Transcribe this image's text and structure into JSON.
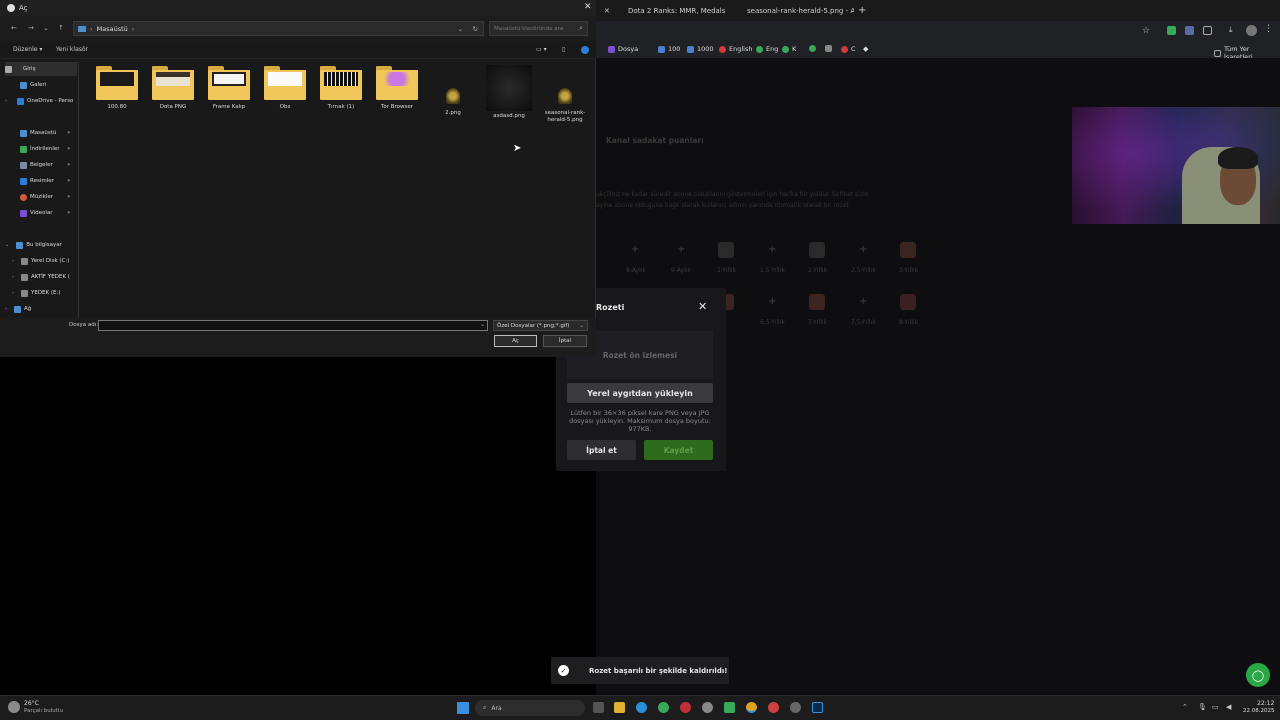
{
  "browser": {
    "tabs": [
      {
        "label": "Dota 2 Ranks: MMR, Medals an"
      },
      {
        "label": "seasonal-rank-herald-5.png - A"
      }
    ],
    "new_tab_icon": "plus-icon",
    "bookmarks": [
      {
        "label": "Dosya",
        "color": "#7a4fd1"
      },
      {
        "label": "100",
        "color": "#4a7fd1"
      },
      {
        "label": "1000",
        "color": "#4a7fd1"
      },
      {
        "label": "English",
        "color": "#d13a3a"
      },
      {
        "label": "Eng",
        "color": "#3aa85a"
      },
      {
        "label": "K",
        "color": "#3aa85a"
      },
      {
        "label": "C",
        "color": "#d13a3a"
      }
    ],
    "all_bookmarks": "Tüm Yer İşaretleri"
  },
  "page": {
    "section_title": "Kanal sadakat puanları",
    "desc_line1": "ukçiliniz ne kadar süredir abone olduklarını göstermeleri için harika bir yoldur. Sohbet sizin",
    "desc_line2": "ayine abone olduğuna bağlı olarak kullanıcı adının yanında otomatik olarak bir rozet",
    "row1_labels": [
      "8-Aylık",
      "9-Aylık",
      "1-Yıllık",
      "1,5-Yıllık",
      "2-Yıllık",
      "2,5-Yıllık",
      "3-Yıllık"
    ],
    "row2_labels": [
      "6,5-Yıllık",
      "7-Yıllık",
      "7,5-Yıllık",
      "8-Yıllık"
    ]
  },
  "badge_modal": {
    "title": "Rozeti",
    "preview_label": "Rozet ön izlemesi",
    "upload_label": "Yerel aygıtdan yükleyin",
    "hint": "Lütfen bir 36×36 piksel kare PNG veya JPG dosyası yükleyin. Maksimum dosya boyutu: 977KB.",
    "cancel_label": "İptal et",
    "save_label": "Kaydet",
    "save_color": "#2f6b1e"
  },
  "toast": {
    "message": "Rozet başarılı bir şekilde kaldırıldı!"
  },
  "file_dialog": {
    "title": "Aç",
    "path_root": "Masaüstü",
    "search_placeholder": "Masaüstü klasöründe ara",
    "toolbar": {
      "organize": "Düzenle",
      "new_folder": "Yeni klasör"
    },
    "sidebar": [
      {
        "label": "Giriş",
        "icon": "home-icon",
        "color": "#aaaaaa",
        "pinned": false
      },
      {
        "label": "Galeri",
        "icon": "gallery-icon",
        "color": "#4a8fd1",
        "pinned": false
      },
      {
        "label": "OneDrive - Perso",
        "icon": "cloud-icon",
        "color": "#2b7fd6",
        "pinned": false
      },
      {
        "label": "Masaüstü",
        "icon": "desktop-icon",
        "color": "#4a8fd1",
        "pinned": true
      },
      {
        "label": "İndirilenler",
        "icon": "download-icon",
        "color": "#3aa85a",
        "pinned": true
      },
      {
        "label": "Belgeler",
        "icon": "document-icon",
        "color": "#7a8aa0",
        "pinned": true
      },
      {
        "label": "Resimler",
        "icon": "picture-icon",
        "color": "#2b7fd6",
        "pinned": true
      },
      {
        "label": "Müzikler",
        "icon": "music-icon",
        "color": "#d15a3a",
        "pinned": true
      },
      {
        "label": "Videolar",
        "icon": "video-icon",
        "color": "#7a4fd1",
        "pinned": true
      },
      {
        "label": "Bu bilgisayar",
        "icon": "computer-icon",
        "color": "#4a8fd1",
        "pinned": false
      },
      {
        "label": "Yerel Disk (C:)",
        "icon": "disk-icon",
        "color": "#888888",
        "pinned": false
      },
      {
        "label": "AKTİF YEDEK (",
        "icon": "disk-icon",
        "color": "#888888",
        "pinned": false
      },
      {
        "label": "YEDEK (E:)",
        "icon": "disk-icon",
        "color": "#888888",
        "pinned": false
      },
      {
        "label": "Ağ",
        "icon": "network-icon",
        "color": "#4a8fd1",
        "pinned": false
      }
    ],
    "files": [
      {
        "name": "100.80",
        "type": "folder"
      },
      {
        "name": "Dota PNG",
        "type": "folder"
      },
      {
        "name": "Frame Kalıp",
        "type": "folder"
      },
      {
        "name": "Obs",
        "type": "folder"
      },
      {
        "name": "Tırnak (1)",
        "type": "folder"
      },
      {
        "name": "Tor Browser",
        "type": "folder"
      },
      {
        "name": "2.png",
        "type": "png"
      },
      {
        "name": "asdasd.png",
        "type": "dark"
      },
      {
        "name": "seasonal-rank-herald-5.png",
        "type": "png"
      }
    ],
    "filename_label": "Dosya adı:",
    "filename_value": "",
    "filetype": "Özel Dosyalar (*.png;*.gif)",
    "open_label": "Aç",
    "cancel_label": "İptal"
  },
  "taskbar": {
    "weather_temp": "26°C",
    "weather_desc": "Parçalı bulutlu",
    "search_label": "Ara",
    "time": "22:12",
    "date": "22.08.2025"
  }
}
